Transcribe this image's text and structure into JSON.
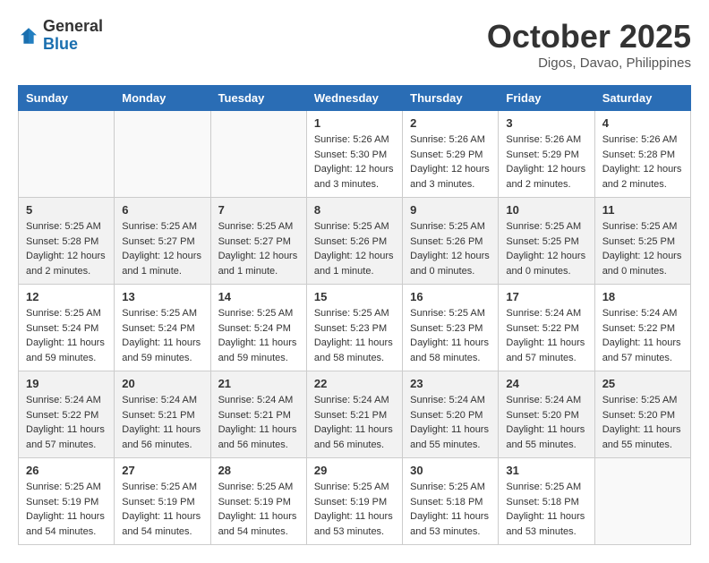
{
  "header": {
    "logo_general": "General",
    "logo_blue": "Blue",
    "month_title": "October 2025",
    "location": "Digos, Davao, Philippines"
  },
  "days_of_week": [
    "Sunday",
    "Monday",
    "Tuesday",
    "Wednesday",
    "Thursday",
    "Friday",
    "Saturday"
  ],
  "weeks": [
    [
      {
        "day": "",
        "info": ""
      },
      {
        "day": "",
        "info": ""
      },
      {
        "day": "",
        "info": ""
      },
      {
        "day": "1",
        "info": "Sunrise: 5:26 AM\nSunset: 5:30 PM\nDaylight: 12 hours and 3 minutes."
      },
      {
        "day": "2",
        "info": "Sunrise: 5:26 AM\nSunset: 5:29 PM\nDaylight: 12 hours and 3 minutes."
      },
      {
        "day": "3",
        "info": "Sunrise: 5:26 AM\nSunset: 5:29 PM\nDaylight: 12 hours and 2 minutes."
      },
      {
        "day": "4",
        "info": "Sunrise: 5:26 AM\nSunset: 5:28 PM\nDaylight: 12 hours and 2 minutes."
      }
    ],
    [
      {
        "day": "5",
        "info": "Sunrise: 5:25 AM\nSunset: 5:28 PM\nDaylight: 12 hours and 2 minutes."
      },
      {
        "day": "6",
        "info": "Sunrise: 5:25 AM\nSunset: 5:27 PM\nDaylight: 12 hours and 1 minute."
      },
      {
        "day": "7",
        "info": "Sunrise: 5:25 AM\nSunset: 5:27 PM\nDaylight: 12 hours and 1 minute."
      },
      {
        "day": "8",
        "info": "Sunrise: 5:25 AM\nSunset: 5:26 PM\nDaylight: 12 hours and 1 minute."
      },
      {
        "day": "9",
        "info": "Sunrise: 5:25 AM\nSunset: 5:26 PM\nDaylight: 12 hours and 0 minutes."
      },
      {
        "day": "10",
        "info": "Sunrise: 5:25 AM\nSunset: 5:25 PM\nDaylight: 12 hours and 0 minutes."
      },
      {
        "day": "11",
        "info": "Sunrise: 5:25 AM\nSunset: 5:25 PM\nDaylight: 12 hours and 0 minutes."
      }
    ],
    [
      {
        "day": "12",
        "info": "Sunrise: 5:25 AM\nSunset: 5:24 PM\nDaylight: 11 hours and 59 minutes."
      },
      {
        "day": "13",
        "info": "Sunrise: 5:25 AM\nSunset: 5:24 PM\nDaylight: 11 hours and 59 minutes."
      },
      {
        "day": "14",
        "info": "Sunrise: 5:25 AM\nSunset: 5:24 PM\nDaylight: 11 hours and 59 minutes."
      },
      {
        "day": "15",
        "info": "Sunrise: 5:25 AM\nSunset: 5:23 PM\nDaylight: 11 hours and 58 minutes."
      },
      {
        "day": "16",
        "info": "Sunrise: 5:25 AM\nSunset: 5:23 PM\nDaylight: 11 hours and 58 minutes."
      },
      {
        "day": "17",
        "info": "Sunrise: 5:24 AM\nSunset: 5:22 PM\nDaylight: 11 hours and 57 minutes."
      },
      {
        "day": "18",
        "info": "Sunrise: 5:24 AM\nSunset: 5:22 PM\nDaylight: 11 hours and 57 minutes."
      }
    ],
    [
      {
        "day": "19",
        "info": "Sunrise: 5:24 AM\nSunset: 5:22 PM\nDaylight: 11 hours and 57 minutes."
      },
      {
        "day": "20",
        "info": "Sunrise: 5:24 AM\nSunset: 5:21 PM\nDaylight: 11 hours and 56 minutes."
      },
      {
        "day": "21",
        "info": "Sunrise: 5:24 AM\nSunset: 5:21 PM\nDaylight: 11 hours and 56 minutes."
      },
      {
        "day": "22",
        "info": "Sunrise: 5:24 AM\nSunset: 5:21 PM\nDaylight: 11 hours and 56 minutes."
      },
      {
        "day": "23",
        "info": "Sunrise: 5:24 AM\nSunset: 5:20 PM\nDaylight: 11 hours and 55 minutes."
      },
      {
        "day": "24",
        "info": "Sunrise: 5:24 AM\nSunset: 5:20 PM\nDaylight: 11 hours and 55 minutes."
      },
      {
        "day": "25",
        "info": "Sunrise: 5:25 AM\nSunset: 5:20 PM\nDaylight: 11 hours and 55 minutes."
      }
    ],
    [
      {
        "day": "26",
        "info": "Sunrise: 5:25 AM\nSunset: 5:19 PM\nDaylight: 11 hours and 54 minutes."
      },
      {
        "day": "27",
        "info": "Sunrise: 5:25 AM\nSunset: 5:19 PM\nDaylight: 11 hours and 54 minutes."
      },
      {
        "day": "28",
        "info": "Sunrise: 5:25 AM\nSunset: 5:19 PM\nDaylight: 11 hours and 54 minutes."
      },
      {
        "day": "29",
        "info": "Sunrise: 5:25 AM\nSunset: 5:19 PM\nDaylight: 11 hours and 53 minutes."
      },
      {
        "day": "30",
        "info": "Sunrise: 5:25 AM\nSunset: 5:18 PM\nDaylight: 11 hours and 53 minutes."
      },
      {
        "day": "31",
        "info": "Sunrise: 5:25 AM\nSunset: 5:18 PM\nDaylight: 11 hours and 53 minutes."
      },
      {
        "day": "",
        "info": ""
      }
    ]
  ]
}
